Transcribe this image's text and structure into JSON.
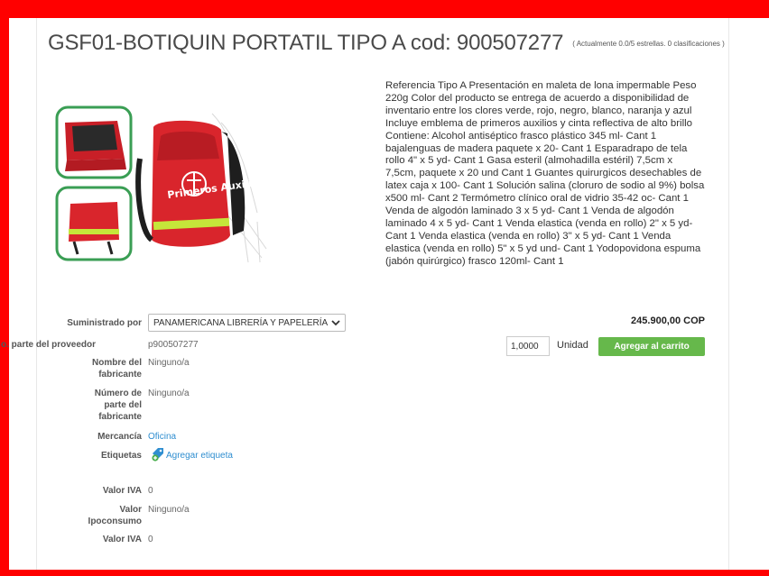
{
  "product": {
    "title": "GSF01-BOTIQUIN PORTATIL TIPO A cod: 900507277",
    "rating": "( Actualmente 0.0/5 estrellas. 0 clasificaciones )",
    "image_text": "Primeros Auxilios",
    "description": "Referencia Tipo A Presentación en maleta de lona impermable Peso 220g Color del producto se entrega de acuerdo a disponibilidad de inventario entre los clores verde, rojo, negro, blanco, naranja y azul Incluye emblema de primeros auxilios y cinta reflectiva de alto brillo Contiene: Alcohol antiséptico frasco plástico 345 ml- Cant 1 bajalenguas de madera paquete x 20- Cant 1 Esparadrapo de tela rollo 4\" x 5 yd- Cant 1 Gasa esteril (almohadilla estéril) 7,5cm x 7,5cm, paquete x 20 und Cant 1 Guantes quirurgicos desechables de latex caja x 100- Cant 1 Solución salina (cloruro de sodio al 9%) bolsa x500 ml- Cant 2 Termómetro clínico oral de vidrio 35-42 oc- Cant 1 Venda de algodón laminado 3 x 5 yd- Cant 1 Venda de algodón laminado 4 x 5 yd- Cant 1 Venda elastica (venda en rollo) 2\" x 5 yd- Cant 1 Venda elastica (venda en rollo) 3\" x 5 yd- Cant 1 Venda elastica (venda en rollo) 5\" x 5 yd und- Cant 1 Yodopovidona espuma (jabón quirúrgico) frasco 120ml- Cant 1",
    "price": "245.900,00 COP"
  },
  "purchase": {
    "quantity": "1,0000",
    "unit": "Unidad",
    "add_to_cart": "Agregar al carrito"
  },
  "details": {
    "supplier_label": "Suministrado por",
    "supplier_value": "PANAMERICANA LIBRERÍA Y PAPELERÍA",
    "part_label": "o. parte del proveedor",
    "part_value": "p900507277",
    "maker_name_label": "Nombre del fabricante",
    "maker_name_value": "Ninguno/a",
    "maker_part_label": "Número de parte del fabricante",
    "maker_part_value": "Ninguno/a",
    "merch_label": "Mercancía",
    "merch_value": "Oficina",
    "tags_label": "Etiquetas",
    "tags_value": "Agregar etiqueta",
    "iva_label": "Valor IVA",
    "iva_value": "0",
    "ipo_label": "Valor Ipoconsumo",
    "ipo_value": "Ninguno/a",
    "iva2_label": "Valor IVA",
    "iva2_value": "0"
  },
  "colors": {
    "frame": "#ff0000",
    "cart_button": "#66b84b",
    "link": "#2f8ed0",
    "bag_red": "#d9252c",
    "thumb_border": "#3a9e54"
  }
}
